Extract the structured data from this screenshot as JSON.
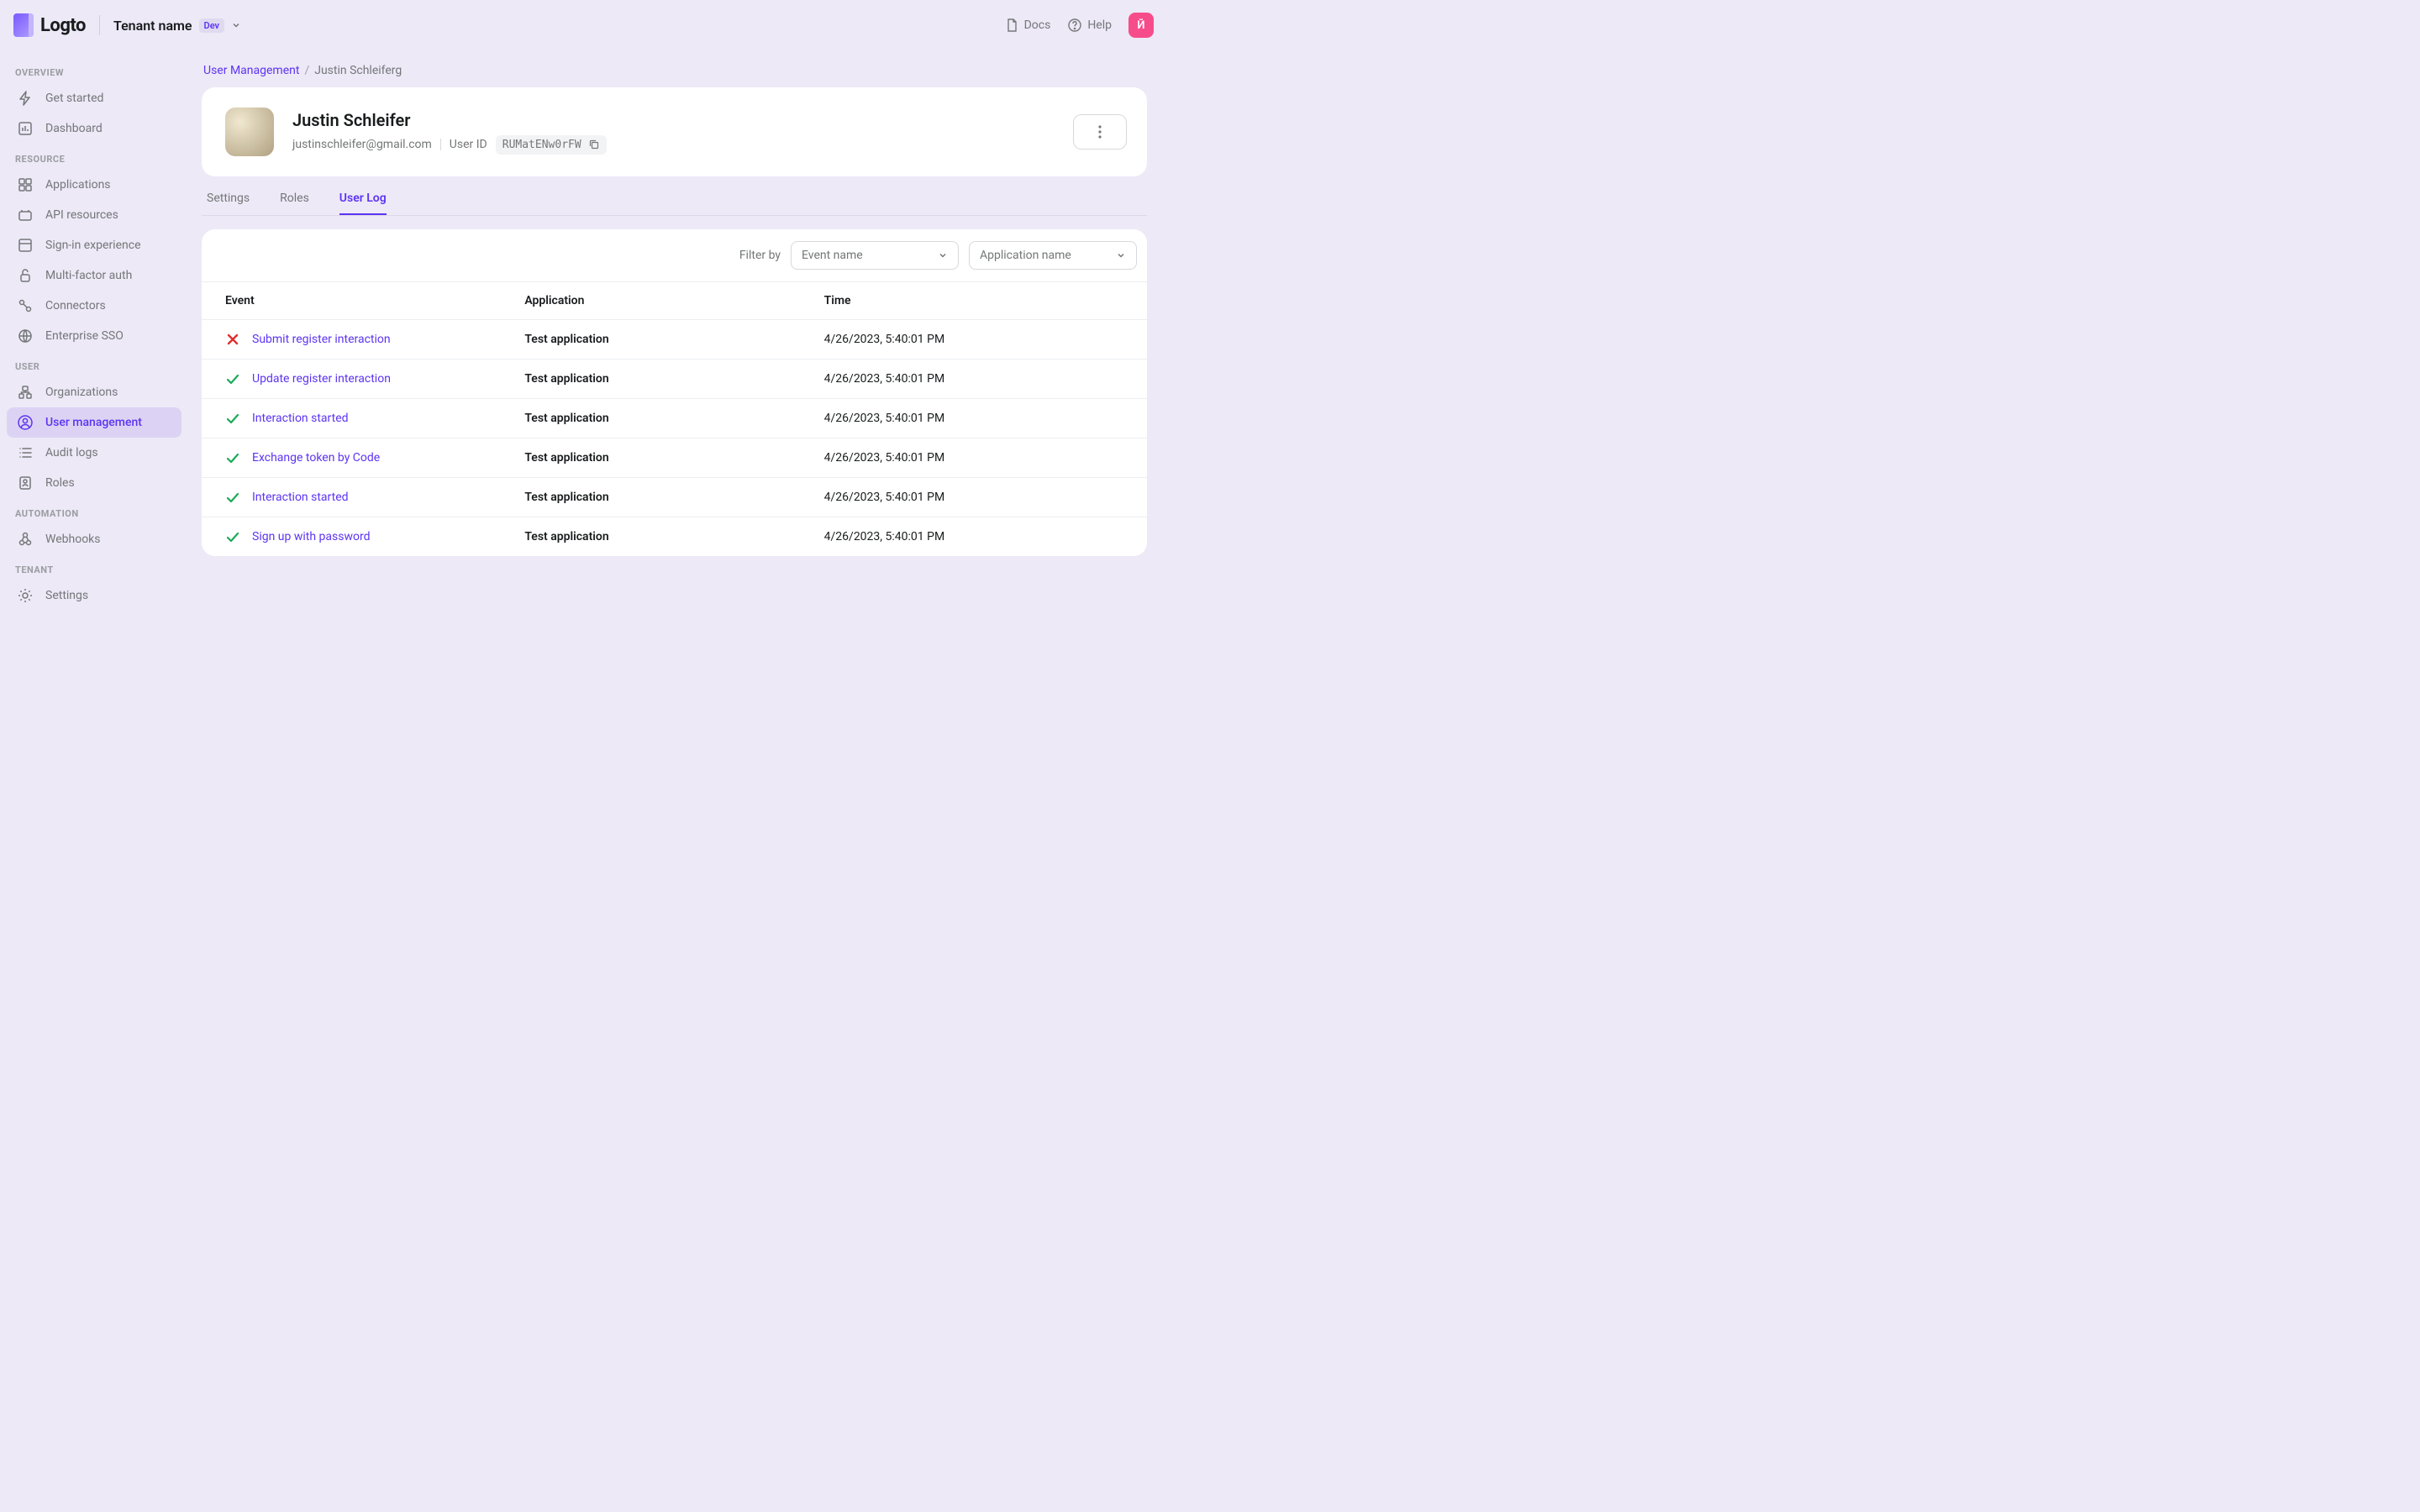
{
  "brand": {
    "name": "Logto"
  },
  "tenant": {
    "name": "Tenant name",
    "badge": "Dev"
  },
  "topbar": {
    "docs": "Docs",
    "help": "Help",
    "avatar_initial": "Й"
  },
  "sidebar": {
    "sections": [
      {
        "label": "OVERVIEW",
        "items": [
          {
            "id": "get-started",
            "label": "Get started",
            "icon": "bolt"
          },
          {
            "id": "dashboard",
            "label": "Dashboard",
            "icon": "chart"
          }
        ]
      },
      {
        "label": "RESOURCE",
        "items": [
          {
            "id": "applications",
            "label": "Applications",
            "icon": "grid"
          },
          {
            "id": "api-resources",
            "label": "API resources",
            "icon": "api"
          },
          {
            "id": "sign-in-experience",
            "label": "Sign-in experience",
            "icon": "signin"
          },
          {
            "id": "mfa",
            "label": "Multi-factor auth",
            "icon": "lock"
          },
          {
            "id": "connectors",
            "label": "Connectors",
            "icon": "connector"
          },
          {
            "id": "enterprise-sso",
            "label": "Enterprise SSO",
            "icon": "sso"
          }
        ]
      },
      {
        "label": "USER",
        "items": [
          {
            "id": "organizations",
            "label": "Organizations",
            "icon": "org"
          },
          {
            "id": "user-management",
            "label": "User management",
            "icon": "user",
            "active": true
          },
          {
            "id": "audit-logs",
            "label": "Audit logs",
            "icon": "list"
          },
          {
            "id": "roles",
            "label": "Roles",
            "icon": "role"
          }
        ]
      },
      {
        "label": "AUTOMATION",
        "items": [
          {
            "id": "webhooks",
            "label": "Webhooks",
            "icon": "webhook"
          }
        ]
      },
      {
        "label": "TENANT",
        "items": [
          {
            "id": "settings",
            "label": "Settings",
            "icon": "gear"
          }
        ]
      }
    ]
  },
  "breadcrumb": {
    "parent": "User Management",
    "current": "Justin Schleiferg"
  },
  "user": {
    "name": "Justin Schleifer",
    "email": "justinschleifer@gmail.com",
    "id_label": "User ID",
    "id": "RUMatENw0rFW"
  },
  "tabs": [
    {
      "id": "settings",
      "label": "Settings"
    },
    {
      "id": "roles",
      "label": "Roles"
    },
    {
      "id": "user-log",
      "label": "User Log",
      "active": true
    }
  ],
  "filters": {
    "label": "Filter by",
    "event": "Event name",
    "application": "Application name"
  },
  "table": {
    "headers": {
      "event": "Event",
      "application": "Application",
      "time": "Time"
    },
    "rows": [
      {
        "status": "fail",
        "event": "Submit register interaction",
        "application": "Test application",
        "time": "4/26/2023, 5:40:01 PM"
      },
      {
        "status": "ok",
        "event": "Update register interaction",
        "application": "Test application",
        "time": "4/26/2023, 5:40:01 PM"
      },
      {
        "status": "ok",
        "event": "Interaction started",
        "application": "Test application",
        "time": "4/26/2023, 5:40:01 PM"
      },
      {
        "status": "ok",
        "event": "Exchange token by Code",
        "application": "Test application",
        "time": "4/26/2023, 5:40:01 PM"
      },
      {
        "status": "ok",
        "event": "Interaction started",
        "application": "Test application",
        "time": "4/26/2023, 5:40:01 PM"
      },
      {
        "status": "ok",
        "event": "Sign up with password",
        "application": "Test application",
        "time": "4/26/2023, 5:40:01 PM"
      }
    ]
  }
}
